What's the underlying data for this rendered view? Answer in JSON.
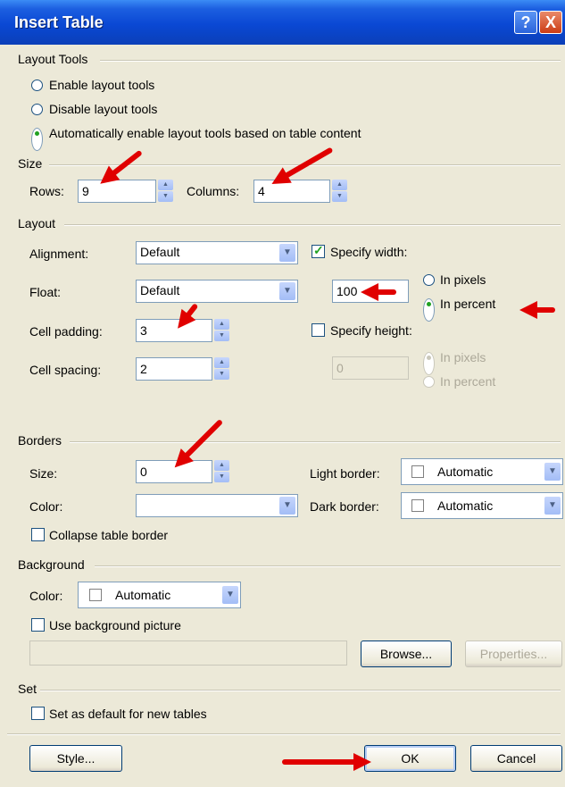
{
  "title": "Insert Table",
  "title_buttons": {
    "help": "?",
    "close": "X"
  },
  "layout_tools": {
    "group": "Layout Tools",
    "enable": "Enable layout tools",
    "disable": "Disable layout tools",
    "auto": "Automatically enable layout tools based on table content"
  },
  "size": {
    "group": "Size",
    "rows_label": "Rows:",
    "rows_value": "9",
    "columns_label": "Columns:",
    "columns_value": "4"
  },
  "layout": {
    "group": "Layout",
    "alignment_label": "Alignment:",
    "alignment_value": "Default",
    "float_label": "Float:",
    "float_value": "Default",
    "cell_padding_label": "Cell padding:",
    "cell_padding_value": "3",
    "cell_spacing_label": "Cell spacing:",
    "cell_spacing_value": "2",
    "specify_width": "Specify width:",
    "width_value": "100",
    "width_in_pixels": "In pixels",
    "width_in_percent": "In percent",
    "specify_height": "Specify height:",
    "height_value": "0",
    "height_in_pixels": "In pixels",
    "height_in_percent": "In percent"
  },
  "borders": {
    "group": "Borders",
    "size_label": "Size:",
    "size_value": "0",
    "color_label": "Color:",
    "color_value": "",
    "light_border_label": "Light border:",
    "light_border_value": "Automatic",
    "dark_border_label": "Dark border:",
    "dark_border_value": "Automatic",
    "collapse": "Collapse table border"
  },
  "background": {
    "group": "Background",
    "color_label": "Color:",
    "color_value": "Automatic",
    "use_picture": "Use background picture",
    "picture_path": "",
    "browse": "Browse...",
    "properties": "Properties..."
  },
  "set": {
    "group": "Set",
    "default": "Set as default for new tables"
  },
  "footer": {
    "style": "Style...",
    "ok": "OK",
    "cancel": "Cancel"
  },
  "colors": {
    "title_bar": "#0a48d4",
    "dialog_bg": "#ece9d8",
    "annotation_arrow": "#e00000"
  }
}
